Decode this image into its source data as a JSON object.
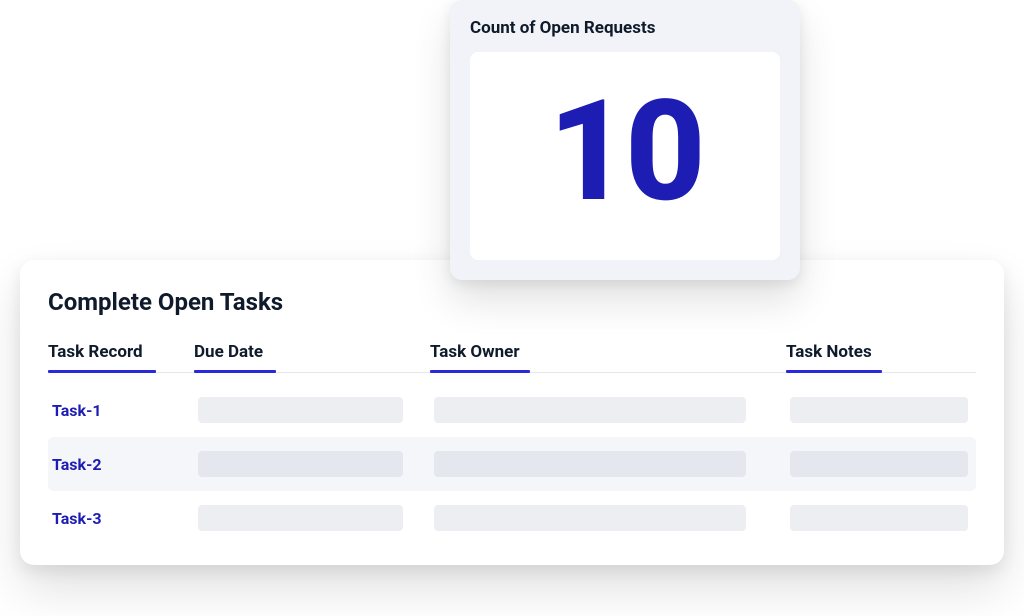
{
  "metric": {
    "title": "Count of Open Requests",
    "value": "10"
  },
  "tasks": {
    "title": "Complete Open Tasks",
    "headers": {
      "record": "Task Record",
      "due": "Due Date",
      "owner": "Task Owner",
      "notes": "Task Notes"
    },
    "rows": [
      {
        "record": "Task-1"
      },
      {
        "record": "Task-2"
      },
      {
        "record": "Task-3"
      }
    ]
  }
}
